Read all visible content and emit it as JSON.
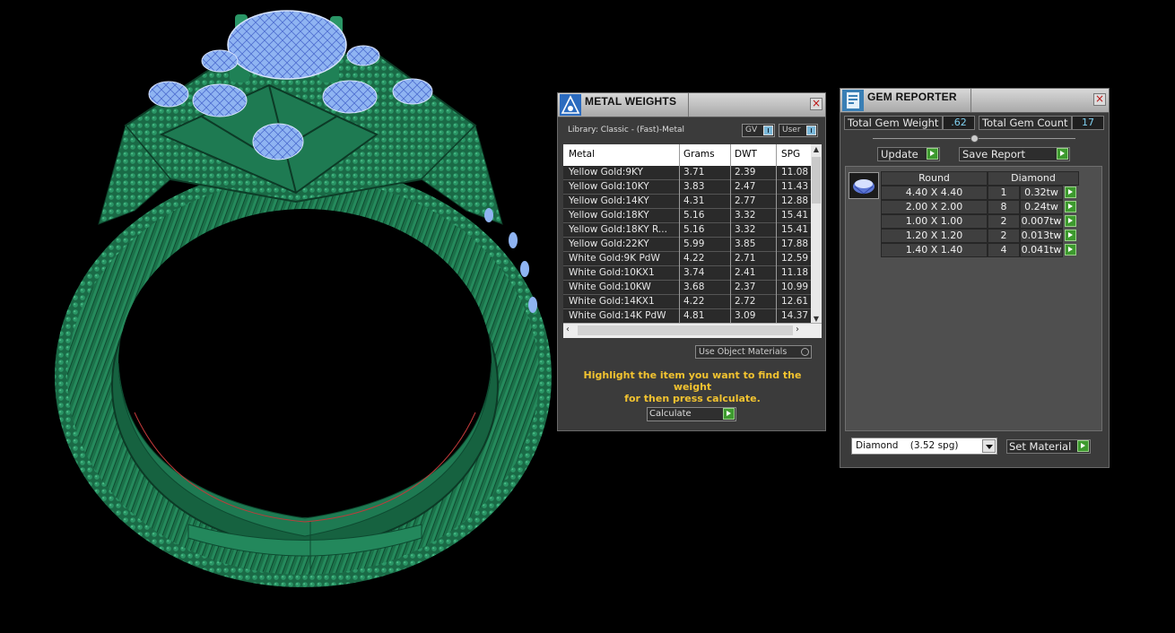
{
  "metal_weights": {
    "title": "METAL WEIGHTS",
    "library_label": "Library: Classic - (Fast)-Metal",
    "gv_label": "GV",
    "user_label": "User",
    "columns": [
      "Metal",
      "Grams",
      "DWT",
      "SPG"
    ],
    "rows": [
      {
        "metal": "Yellow Gold:9KY",
        "grams": "3.71",
        "dwt": "2.39",
        "spg": "11.08"
      },
      {
        "metal": "Yellow Gold:10KY",
        "grams": "3.83",
        "dwt": "2.47",
        "spg": "11.43"
      },
      {
        "metal": "Yellow Gold:14KY",
        "grams": "4.31",
        "dwt": "2.77",
        "spg": "12.88"
      },
      {
        "metal": "Yellow Gold:18KY",
        "grams": "5.16",
        "dwt": "3.32",
        "spg": "15.41"
      },
      {
        "metal": "Yellow Gold:18KY R...",
        "grams": "5.16",
        "dwt": "3.32",
        "spg": "15.41"
      },
      {
        "metal": "Yellow Gold:22KY",
        "grams": "5.99",
        "dwt": "3.85",
        "spg": "17.88"
      },
      {
        "metal": "White Gold:9K PdW",
        "grams": "4.22",
        "dwt": "2.71",
        "spg": "12.59"
      },
      {
        "metal": "White Gold:10KX1",
        "grams": "3.74",
        "dwt": "2.41",
        "spg": "11.18"
      },
      {
        "metal": "White Gold:10KW",
        "grams": "3.68",
        "dwt": "2.37",
        "spg": "10.99"
      },
      {
        "metal": "White Gold:14KX1",
        "grams": "4.22",
        "dwt": "2.72",
        "spg": "12.61"
      },
      {
        "metal": "White Gold:14K PdW",
        "grams": "4.81",
        "dwt": "3.09",
        "spg": "14.37"
      }
    ],
    "use_object_materials_label": "Use Object Materials",
    "hint_line1": "Highlight the item you want to find the weight",
    "hint_line2": "for then press calculate.",
    "calculate_label": "Calculate"
  },
  "gem_reporter": {
    "title": "GEM REPORTER",
    "total_gem_weight_label": "Total Gem Weight",
    "total_gem_weight_value": ".62",
    "total_gem_count_label": "Total Gem Count",
    "total_gem_count_value": "17",
    "update_label": "Update",
    "save_report_label": "Save Report",
    "table_header_shape": "Round",
    "table_header_material": "Diamond",
    "gems": [
      {
        "size": "4.40 X 4.40",
        "count": "1",
        "weight": "0.32tw"
      },
      {
        "size": "2.00 X 2.00",
        "count": "8",
        "weight": "0.24tw"
      },
      {
        "size": "1.00 X 1.00",
        "count": "2",
        "weight": "0.007tw"
      },
      {
        "size": "1.20 X 1.20",
        "count": "2",
        "weight": "0.013tw"
      },
      {
        "size": "1.40 X 1.40",
        "count": "4",
        "weight": "0.041tw"
      }
    ],
    "material_dropdown_value": "Diamond    (3.52 spg)",
    "set_material_label": "Set Material"
  },
  "colors": {
    "ring_metal": "#1e7a52",
    "gem_blue": "#8fb4f2",
    "hint_yellow": "#f2c330",
    "value_cyan": "#7fd0f0",
    "button_green": "#3d9a2e"
  }
}
